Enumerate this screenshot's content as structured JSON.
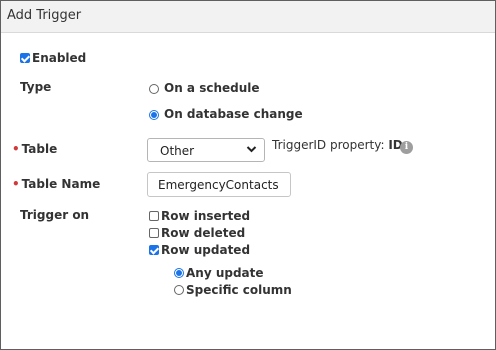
{
  "dialog": {
    "title": "Add Trigger"
  },
  "form": {
    "enabled": {
      "label": "Enabled",
      "checked": true
    },
    "type": {
      "label": "Type",
      "options": [
        {
          "label": "On a schedule",
          "selected": false
        },
        {
          "label": "On database change",
          "selected": true
        }
      ]
    },
    "table": {
      "required_marker": "•",
      "label": "Table",
      "selected": "Other",
      "property_prefix": "TriggerID property: ",
      "property_value": "ID",
      "info_icon": "i"
    },
    "table_name": {
      "required_marker": "•",
      "label": "Table Name",
      "value": "EmergencyContacts"
    },
    "trigger_on": {
      "label": "Trigger on",
      "options": [
        {
          "label": "Row inserted",
          "checked": false
        },
        {
          "label": "Row deleted",
          "checked": false
        },
        {
          "label": "Row updated",
          "checked": true
        }
      ],
      "update_scope": [
        {
          "label": "Any update",
          "selected": true
        },
        {
          "label": "Specific column",
          "selected": false
        }
      ]
    }
  },
  "colors": {
    "accent": "#1a73e8",
    "required": "#d03a3a",
    "titlebar": "#f2f2f2"
  },
  "icons": {
    "select_chevron": "chevron-down-icon",
    "info": "info-icon"
  }
}
